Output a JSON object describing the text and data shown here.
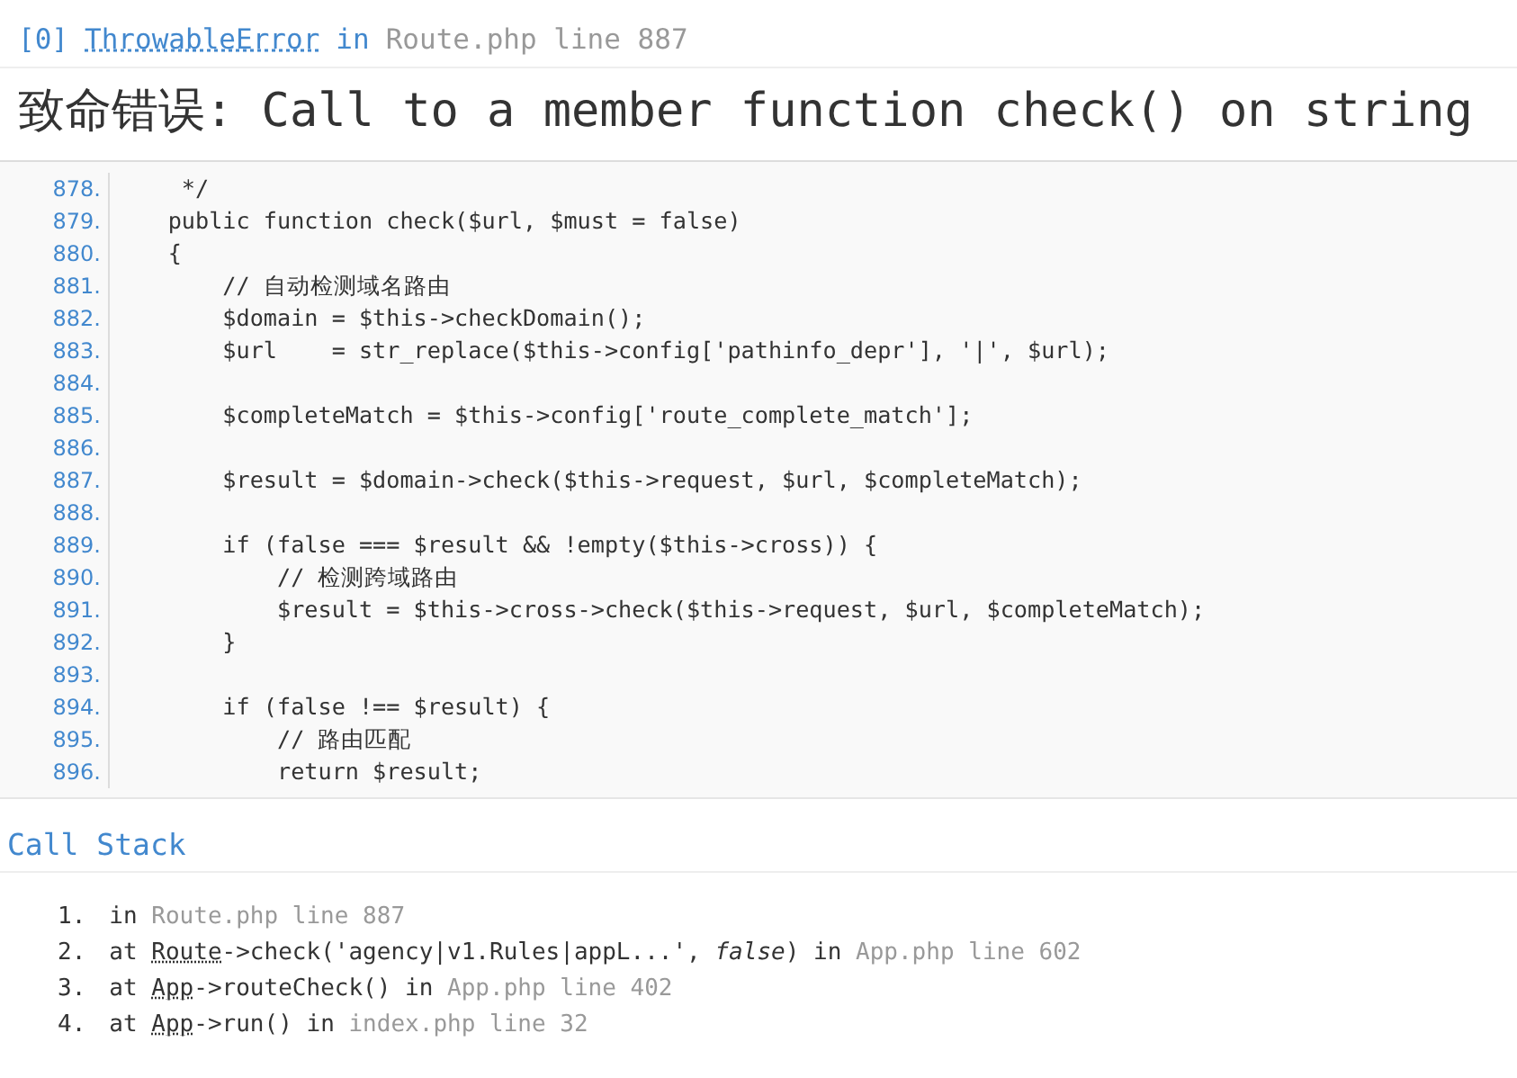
{
  "exception": {
    "index": "[0]",
    "class": "ThrowableError",
    "connector": "in",
    "location": "Route.php line 887"
  },
  "message": "致命错误: Call to a member function check() on string",
  "source": {
    "lines": [
      {
        "number": "878.",
        "code": "     */"
      },
      {
        "number": "879.",
        "code": "    public function check($url, $must = false)"
      },
      {
        "number": "880.",
        "code": "    {"
      },
      {
        "number": "881.",
        "code": "        // 自动检测域名路由"
      },
      {
        "number": "882.",
        "code": "        $domain = $this->checkDomain();"
      },
      {
        "number": "883.",
        "code": "        $url    = str_replace($this->config['pathinfo_depr'], '|', $url);"
      },
      {
        "number": "884."
      },
      {
        "number": "885.",
        "code": "        $completeMatch = $this->config['route_complete_match'];"
      },
      {
        "number": "886."
      },
      {
        "number": "887.",
        "code": "        $result = $domain->check($this->request, $url, $completeMatch);"
      },
      {
        "number": "888."
      },
      {
        "number": "889.",
        "code": "        if (false === $result && !empty($this->cross)) {"
      },
      {
        "number": "890.",
        "code": "            // 检测跨域路由"
      },
      {
        "number": "891.",
        "code": "            $result = $this->cross->check($this->request, $url, $completeMatch);"
      },
      {
        "number": "892.",
        "code": "        }"
      },
      {
        "number": "893."
      },
      {
        "number": "894.",
        "code": "        if (false !== $result) {"
      },
      {
        "number": "895.",
        "code": "            // 路由匹配"
      },
      {
        "number": "896.",
        "code": "            return $result;"
      }
    ]
  },
  "call_stack": {
    "title": "Call Stack",
    "items": [
      {
        "number": "1.",
        "parts": [
          {
            "kind": "text",
            "text": "in"
          },
          {
            "kind": "file",
            "text": "Route.php line 887"
          }
        ]
      },
      {
        "number": "2.",
        "parts": [
          {
            "kind": "text",
            "text": "at"
          },
          {
            "kind": "class",
            "text": "Route"
          },
          {
            "kind": "text",
            "text": "->check('agency|v1.Rules|appL...', *false*) in"
          },
          {
            "kind": "file",
            "text": "App.php line 602"
          }
        ]
      },
      {
        "number": "3.",
        "parts": [
          {
            "kind": "text",
            "text": "at"
          },
          {
            "kind": "class",
            "text": "App"
          },
          {
            "kind": "text",
            "text": "->routeCheck() in"
          },
          {
            "kind": "file",
            "text": "App.php line 402"
          }
        ]
      },
      {
        "number": "4.",
        "parts": [
          {
            "kind": "text",
            "text": "at"
          },
          {
            "kind": "class",
            "text": "App"
          },
          {
            "kind": "text",
            "text": "->run() in"
          },
          {
            "kind": "file",
            "text": "index.php line 32"
          }
        ]
      }
    ]
  }
}
